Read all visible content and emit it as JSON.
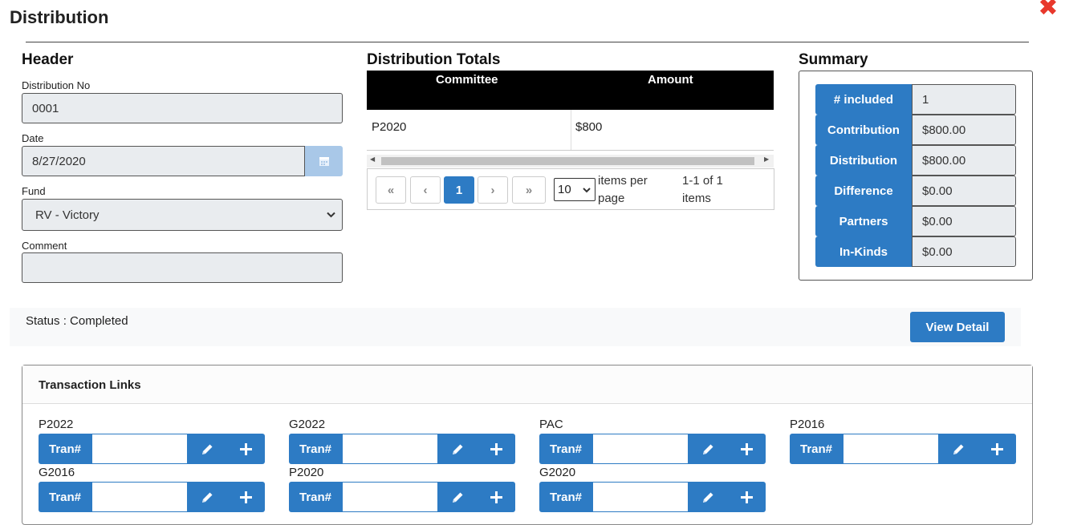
{
  "dialog": {
    "title": "Distribution",
    "close_glyph": "✖"
  },
  "header": {
    "heading": "Header",
    "distribution_no_label": "Distribution No",
    "distribution_no_value": "0001",
    "date_label": "Date",
    "date_value": "8/27/2020",
    "fund_label": "Fund",
    "fund_value": "RV - Victory",
    "comment_label": "Comment",
    "comment_value": ""
  },
  "totals": {
    "heading": "Distribution Totals",
    "columns": [
      "Committee",
      "Amount"
    ],
    "rows": [
      {
        "committee": "P2020",
        "amount": "$800"
      }
    ],
    "pager": {
      "first": "«",
      "prev": "‹",
      "current": "1",
      "next": "›",
      "last": "»",
      "page_size": "10",
      "items_per_page": "items per page",
      "range": "1-1 of 1 items"
    }
  },
  "summary": {
    "heading": "Summary",
    "rows": [
      {
        "label": "# included",
        "value": "1"
      },
      {
        "label": "Contribution",
        "value": "$800.00"
      },
      {
        "label": "Distribution",
        "value": "$800.00"
      },
      {
        "label": "Difference",
        "value": "$0.00"
      },
      {
        "label": "Partners",
        "value": "$0.00"
      },
      {
        "label": "In-Kinds",
        "value": "$0.00"
      }
    ]
  },
  "status": {
    "text": "Status : Completed",
    "view_detail": "View Detail"
  },
  "transaction_links": {
    "title": "Transaction Links",
    "tran_label": "Tran#",
    "items": [
      {
        "name": "P2022"
      },
      {
        "name": "G2022"
      },
      {
        "name": "PAC"
      },
      {
        "name": "P2016"
      },
      {
        "name": "G2016"
      },
      {
        "name": "P2020"
      },
      {
        "name": "G2020"
      }
    ]
  },
  "icons": {
    "calendar": "calendar-icon",
    "edit": "pencil-icon",
    "add": "plus-icon"
  },
  "colors": {
    "primary": "#2d7bc4",
    "close": "#e8382c",
    "grid_header": "#000000"
  }
}
